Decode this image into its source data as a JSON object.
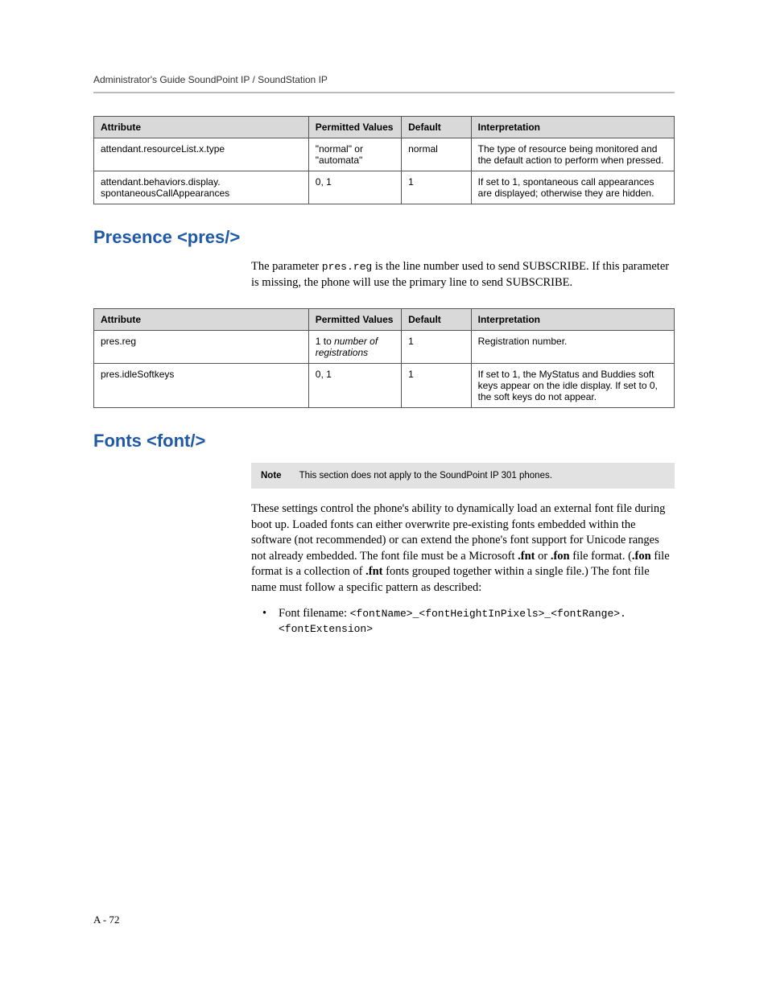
{
  "header": {
    "running_head": "Administrator's Guide SoundPoint IP / SoundStation IP"
  },
  "table1": {
    "headers": {
      "c1": "Attribute",
      "c2": "Permitted Values",
      "c3": "Default",
      "c4": "Interpretation"
    },
    "rows": [
      {
        "c1": "attendant.resourceList.x.type",
        "c2": "\"normal\" or \"automata\"",
        "c3": "normal",
        "c4": "The type of resource being monitored and the default action to perform when pressed."
      },
      {
        "c1": "attendant.behaviors.display. spontaneousCallAppearances",
        "c2": "0, 1",
        "c3": "1",
        "c4": "If set to 1, spontaneous call appearances are displayed; otherwise they are hidden."
      }
    ]
  },
  "presence": {
    "heading": "Presence <pres/>",
    "intro_a": "The parameter ",
    "intro_code": "pres.reg",
    "intro_b": " is the line number used to send SUBSCRIBE. If this parameter is missing, the phone will use the primary line to send SUBSCRIBE."
  },
  "table2": {
    "headers": {
      "c1": "Attribute",
      "c2": "Permitted Values",
      "c3": "Default",
      "c4": "Interpretation"
    },
    "rows": [
      {
        "c1": "pres.reg",
        "c2_a": "1 to ",
        "c2_b": "number of registrations",
        "c3": "1",
        "c4": "Registration number."
      },
      {
        "c1": "pres.idleSoftkeys",
        "c2": "0, 1",
        "c3": "1",
        "c4": "If set to 1, the MyStatus and Buddies soft keys appear on the idle display. If set to 0, the soft keys do not appear."
      }
    ]
  },
  "fonts": {
    "heading": "Fonts <font/>",
    "note_label": "Note",
    "note_text": "This section does not apply to the SoundPoint IP 301 phones.",
    "para_a": "These settings control the phone's ability to dynamically load an external font file during boot up. Loaded fonts can either overwrite pre-existing fonts embedded within the software (not recommended) or can extend the phone's font support for Unicode ranges not already embedded. The font file must be a Microsoft ",
    "para_b": ".fnt",
    "para_c": " or ",
    "para_d": ".fon",
    "para_e": " file format. (",
    "para_f": ".fon",
    "para_g": " file format is a collection of ",
    "para_h": ".fnt",
    "para_i": " fonts grouped together within a single file.) The font file name must follow a specific pattern as described:",
    "bullet_a": "Font filename: ",
    "bullet_b": "<fontName>_<fontHeightInPixels>_<fontRange>.<fontExtension>"
  },
  "page_number": "A - 72"
}
